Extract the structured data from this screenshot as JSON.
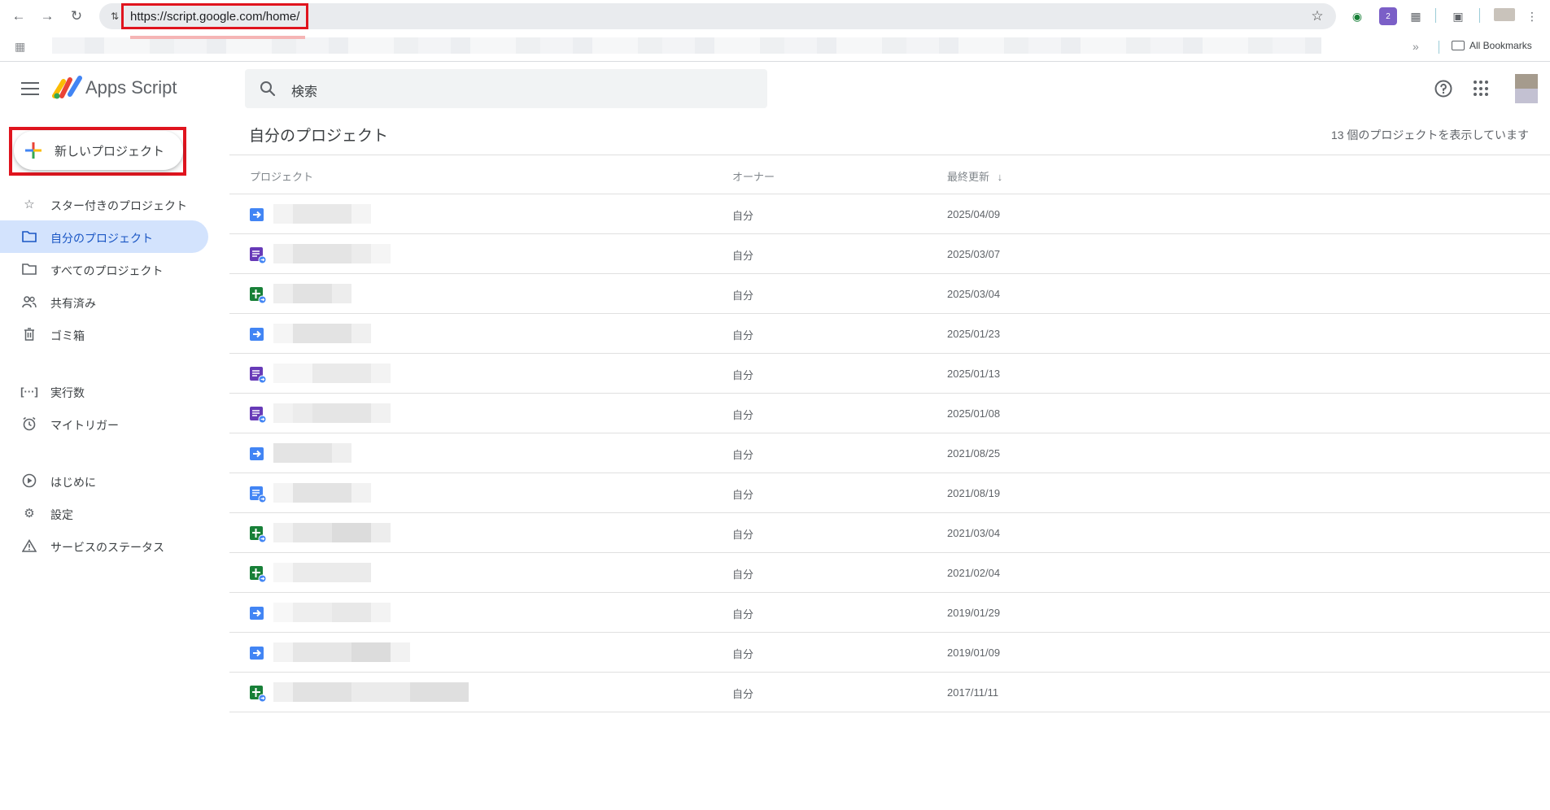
{
  "browser": {
    "url": "https://script.google.com/home/",
    "bookmarks_all_label": "All Bookmarks",
    "extension_badge": "2"
  },
  "app": {
    "title": "Apps Script",
    "search_placeholder": "検索"
  },
  "sidebar": {
    "new_project_label": "新しいプロジェクト",
    "items": [
      {
        "label": "スター付きのプロジェクト",
        "icon": "star-icon"
      },
      {
        "label": "自分のプロジェクト",
        "icon": "folder-icon",
        "active": true
      },
      {
        "label": "すべてのプロジェクト",
        "icon": "folder-icon"
      },
      {
        "label": "共有済み",
        "icon": "people-icon"
      },
      {
        "label": "ゴミ箱",
        "icon": "trash-icon"
      },
      {
        "label": "実行数",
        "icon": "executions-icon"
      },
      {
        "label": "マイトリガー",
        "icon": "alarm-icon"
      },
      {
        "label": "はじめに",
        "icon": "play-circle-icon"
      },
      {
        "label": "設定",
        "icon": "gear-icon"
      },
      {
        "label": "サービスのステータス",
        "icon": "warning-icon"
      }
    ]
  },
  "main": {
    "title": "自分のプロジェクト",
    "count_text": "13 個のプロジェクトを表示しています",
    "columns": {
      "project": "プロジェクト",
      "owner": "オーナー",
      "updated": "最終更新"
    },
    "rows": [
      {
        "type": "standalone",
        "owner": "自分",
        "date": "2025/04/09"
      },
      {
        "type": "forms",
        "owner": "自分",
        "date": "2025/03/07"
      },
      {
        "type": "sheets",
        "owner": "自分",
        "date": "2025/03/04"
      },
      {
        "type": "standalone",
        "owner": "自分",
        "date": "2025/01/23"
      },
      {
        "type": "forms",
        "owner": "自分",
        "date": "2025/01/13"
      },
      {
        "type": "forms",
        "owner": "自分",
        "date": "2025/01/08"
      },
      {
        "type": "standalone",
        "owner": "自分",
        "date": "2021/08/25"
      },
      {
        "type": "docs",
        "owner": "自分",
        "date": "2021/08/19"
      },
      {
        "type": "sheets",
        "owner": "自分",
        "date": "2021/03/04"
      },
      {
        "type": "sheets",
        "owner": "自分",
        "date": "2021/02/04"
      },
      {
        "type": "standalone",
        "owner": "自分",
        "date": "2019/01/29"
      },
      {
        "type": "standalone",
        "owner": "自分",
        "date": "2019/01/09"
      },
      {
        "type": "sheets",
        "owner": "自分",
        "date": "2017/11/11"
      }
    ]
  },
  "colors": {
    "accent": "#1a73e8",
    "highlight_frame": "#e0141e",
    "active_bg": "#d3e3fd",
    "forms": "#673ab7",
    "sheets": "#188038",
    "standalone": "#4285f4"
  }
}
